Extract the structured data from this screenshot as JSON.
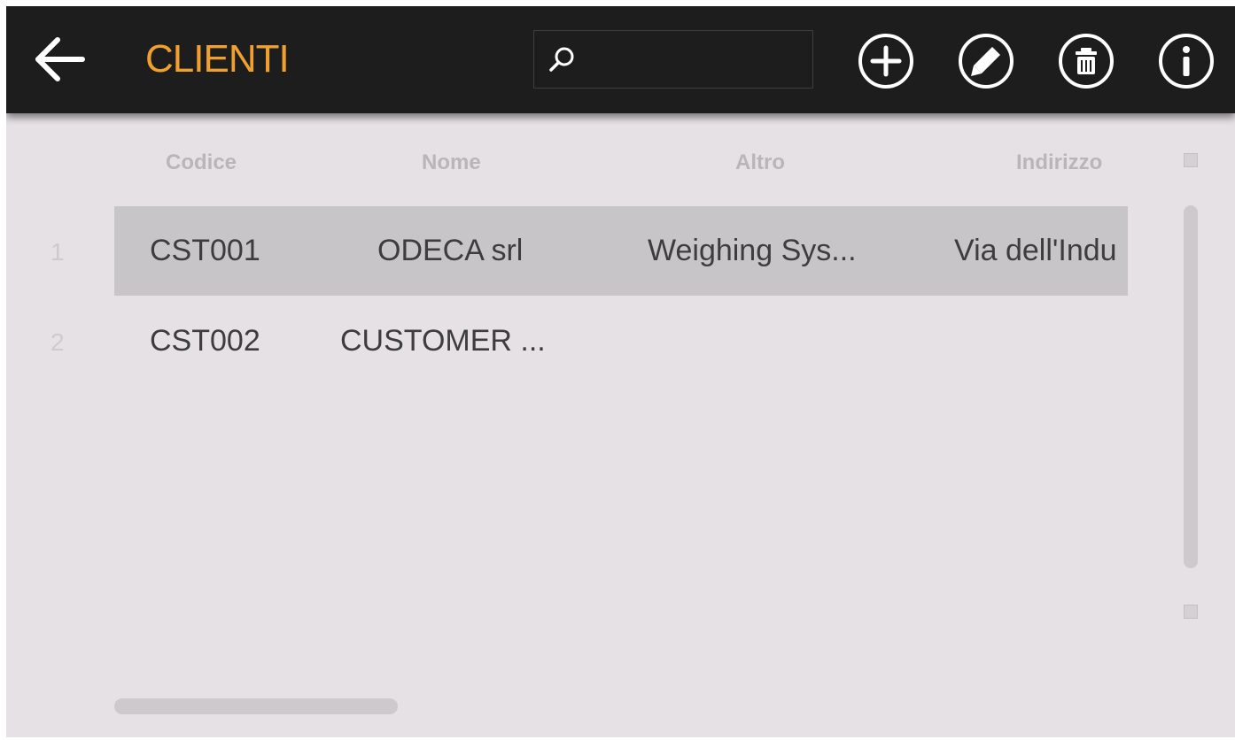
{
  "header": {
    "title": "CLIENTI",
    "back_icon": "arrow-left-icon",
    "title_color": "#efa02f",
    "bar_color": "#1d1d1d"
  },
  "search": {
    "icon": "search-icon",
    "placeholder": "",
    "value": ""
  },
  "toolbar": {
    "buttons": [
      {
        "icon": "add-circle-icon"
      },
      {
        "icon": "edit-circle-icon"
      },
      {
        "icon": "delete-circle-icon"
      },
      {
        "icon": "info-circle-icon"
      }
    ]
  },
  "table": {
    "columns": [
      "Codice",
      "Nome",
      "Altro",
      "Indirizzo"
    ],
    "rows": [
      {
        "num": "1",
        "codice": "CST001",
        "nome": "ODECA srl",
        "altro": "Weighing Sys...",
        "indirizzo": "Via dell'Indu",
        "selected": true
      },
      {
        "num": "2",
        "codice": "CST002",
        "nome": "CUSTOMER ...",
        "altro": "",
        "indirizzo": "",
        "selected": false
      }
    ],
    "selected_row_color": "#c8c5c8",
    "background_color": "#e6e1e5"
  }
}
